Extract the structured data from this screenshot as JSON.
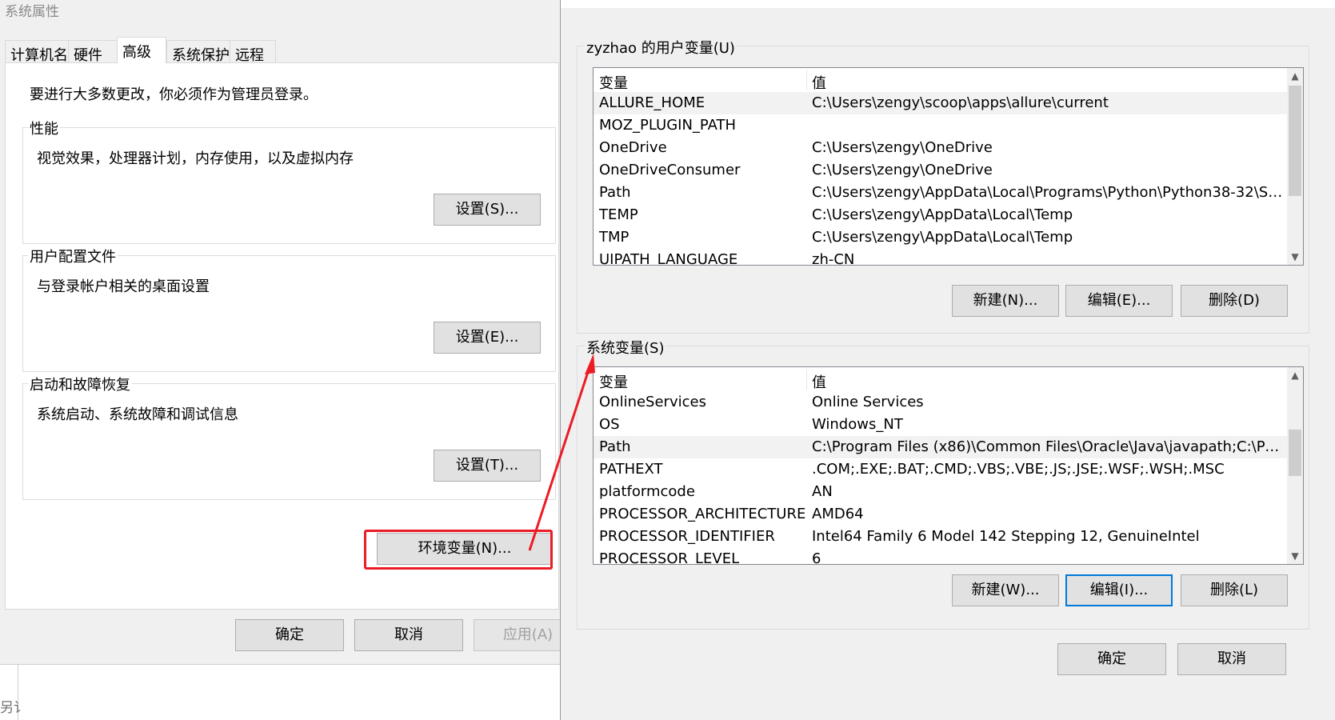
{
  "system_properties": {
    "title": "系统属性",
    "tabs": [
      "计算机名",
      "硬件",
      "高级",
      "系统保护",
      "远程"
    ],
    "active_tab": "高级",
    "admin_note": "要进行大多数更改，你必须作为管理员登录。",
    "groups": [
      {
        "legend": "性能",
        "description": "视觉效果，处理器计划，内存使用，以及虚拟内存",
        "button": "设置(S)..."
      },
      {
        "legend": "用户配置文件",
        "description": "与登录帐户相关的桌面设置",
        "button": "设置(E)..."
      },
      {
        "legend": "启动和故障恢复",
        "description": "系统启动、系统故障和调试信息",
        "button": "设置(T)..."
      }
    ],
    "env_button": "环境变量(N)...",
    "footer": {
      "ok": "确定",
      "cancel": "取消",
      "apply": "应用(A)"
    },
    "fragment_text": "另讠"
  },
  "env_dialog": {
    "user_section_label": "zyzhao 的用户变量(U)",
    "system_section_label": "系统变量(S)",
    "columns": {
      "name": "变量",
      "value": "值"
    },
    "user_vars": [
      {
        "name": "ALLURE_HOME",
        "value": "C:\\Users\\zengy\\scoop\\apps\\allure\\current"
      },
      {
        "name": "MOZ_PLUGIN_PATH",
        "value": ""
      },
      {
        "name": "OneDrive",
        "value": "C:\\Users\\zengy\\OneDrive"
      },
      {
        "name": "OneDriveConsumer",
        "value": "C:\\Users\\zengy\\OneDrive"
      },
      {
        "name": "Path",
        "value": "C:\\Users\\zengy\\AppData\\Local\\Programs\\Python\\Python38-32\\Sc..."
      },
      {
        "name": "TEMP",
        "value": "C:\\Users\\zengy\\AppData\\Local\\Temp"
      },
      {
        "name": "TMP",
        "value": "C:\\Users\\zengy\\AppData\\Local\\Temp"
      },
      {
        "name": "UIPATH_LANGUAGE",
        "value": "zh-CN"
      }
    ],
    "user_selected": "ALLURE_HOME",
    "user_buttons": {
      "new": "新建(N)...",
      "edit": "编辑(E)...",
      "delete": "删除(D)"
    },
    "system_vars": [
      {
        "name": "OnlineServices",
        "value": "Online Services"
      },
      {
        "name": "OS",
        "value": "Windows_NT"
      },
      {
        "name": "Path",
        "value": "C:\\Program Files (x86)\\Common Files\\Oracle\\Java\\javapath;C:\\Pro..."
      },
      {
        "name": "PATHEXT",
        "value": ".COM;.EXE;.BAT;.CMD;.VBS;.VBE;.JS;.JSE;.WSF;.WSH;.MSC"
      },
      {
        "name": "platformcode",
        "value": "AN"
      },
      {
        "name": "PROCESSOR_ARCHITECTURE",
        "value": "AMD64"
      },
      {
        "name": "PROCESSOR_IDENTIFIER",
        "value": "Intel64 Family 6 Model 142 Stepping 12, GenuineIntel"
      },
      {
        "name": "PROCESSOR_LEVEL",
        "value": "6"
      }
    ],
    "system_selected": "Path",
    "system_buttons": {
      "new": "新建(W)...",
      "edit": "编辑(I)...",
      "delete": "删除(L)"
    },
    "footer": {
      "ok": "确定",
      "cancel": "取消"
    }
  },
  "annotation": {
    "color": "#ec1c24",
    "arrow_icon": "red-arrow-icon"
  }
}
